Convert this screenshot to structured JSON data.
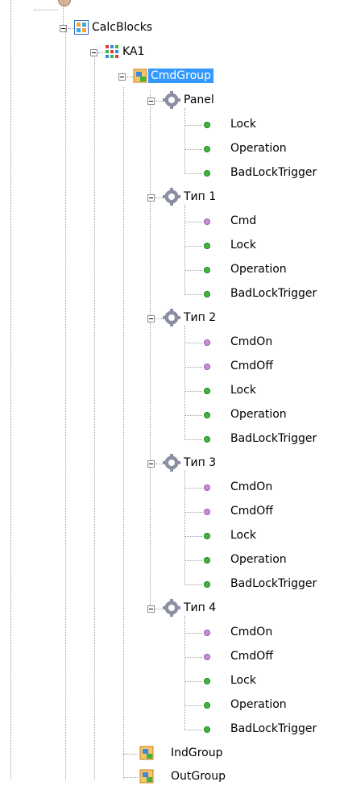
{
  "tree": {
    "calcblocks_label": "CalcBlocks",
    "ka1_label": "KA1",
    "cmdgroup_label": "CmdGroup",
    "indgroup_label": "IndGroup",
    "outgroup_label": "OutGroup",
    "groups": [
      {
        "label": "Panel",
        "items": [
          {
            "label": "Lock",
            "color": "green"
          },
          {
            "label": "Operation",
            "color": "green"
          },
          {
            "label": "BadLockTrigger",
            "color": "green"
          }
        ]
      },
      {
        "label": "Тип 1",
        "items": [
          {
            "label": "Cmd",
            "color": "purple"
          },
          {
            "label": "Lock",
            "color": "green"
          },
          {
            "label": "Operation",
            "color": "green"
          },
          {
            "label": "BadLockTrigger",
            "color": "green"
          }
        ]
      },
      {
        "label": "Тип 2",
        "items": [
          {
            "label": "CmdOn",
            "color": "purple"
          },
          {
            "label": "CmdOff",
            "color": "purple"
          },
          {
            "label": "Lock",
            "color": "green"
          },
          {
            "label": "Operation",
            "color": "green"
          },
          {
            "label": "BadLockTrigger",
            "color": "green"
          }
        ]
      },
      {
        "label": "Тип 3",
        "items": [
          {
            "label": "CmdOn",
            "color": "purple"
          },
          {
            "label": "CmdOff",
            "color": "purple"
          },
          {
            "label": "Lock",
            "color": "green"
          },
          {
            "label": "Operation",
            "color": "green"
          },
          {
            "label": "BadLockTrigger",
            "color": "green"
          }
        ]
      },
      {
        "label": "Тип 4",
        "items": [
          {
            "label": "CmdOn",
            "color": "purple"
          },
          {
            "label": "CmdOff",
            "color": "purple"
          },
          {
            "label": "Lock",
            "color": "green"
          },
          {
            "label": "Operation",
            "color": "green"
          },
          {
            "label": "BadLockTrigger",
            "color": "green"
          }
        ]
      }
    ],
    "colors": {
      "selection": "#3399ff",
      "green_dot": "#3fb43f",
      "purple_dot": "#c58fd6"
    }
  }
}
